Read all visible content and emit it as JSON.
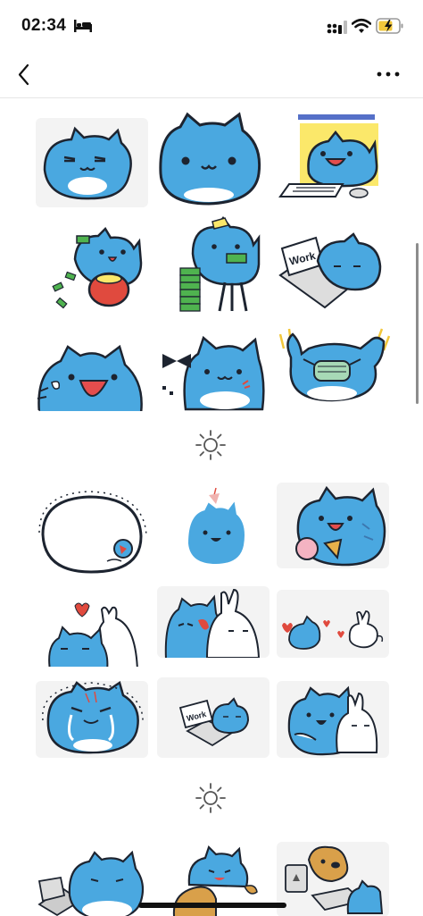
{
  "status_bar": {
    "time": "02:34",
    "icons": [
      "bed-icon",
      "signal-icon",
      "wifi-icon",
      "battery-charging-icon"
    ],
    "battery_color": "#f2c73b"
  },
  "nav": {
    "back_icon": "chevron-left-icon",
    "more_icon": "ellipsis-icon"
  },
  "colors": {
    "cat_blue": "#4aa8e0",
    "outline": "#1d2430",
    "divider_sun": "#555555"
  },
  "stickers": {
    "section1": [
      {
        "name": "sticker-cat-sleepy"
      },
      {
        "name": "sticker-cat-big-face"
      },
      {
        "name": "sticker-cat-typing-keyboard"
      },
      {
        "name": "sticker-cat-money-purse"
      },
      {
        "name": "sticker-cat-money-stack"
      },
      {
        "name": "sticker-cat-work-laptop",
        "sign_text": "Work"
      },
      {
        "name": "sticker-cat-shouting"
      },
      {
        "name": "sticker-cat-bowtie-angry"
      },
      {
        "name": "sticker-cat-mask-cheer"
      }
    ],
    "section2": [
      {
        "name": "sticker-cat-blob-outline"
      },
      {
        "name": "sticker-cat-hanging-small"
      },
      {
        "name": "sticker-cat-eating-cookie"
      },
      {
        "name": "sticker-cat-bunny-heart"
      },
      {
        "name": "sticker-cat-bunny-hug"
      },
      {
        "name": "sticker-cat-bunny-hearts-far"
      },
      {
        "name": "sticker-cat-crying"
      },
      {
        "name": "sticker-cat-laptop-small",
        "sign_text": "Work"
      },
      {
        "name": "sticker-cat-bunny-cuddle"
      }
    ],
    "section3": [
      {
        "name": "sticker-cat-laptop-bottom"
      },
      {
        "name": "sticker-cat-with-dog"
      },
      {
        "name": "sticker-cat-computer-dog"
      }
    ]
  }
}
